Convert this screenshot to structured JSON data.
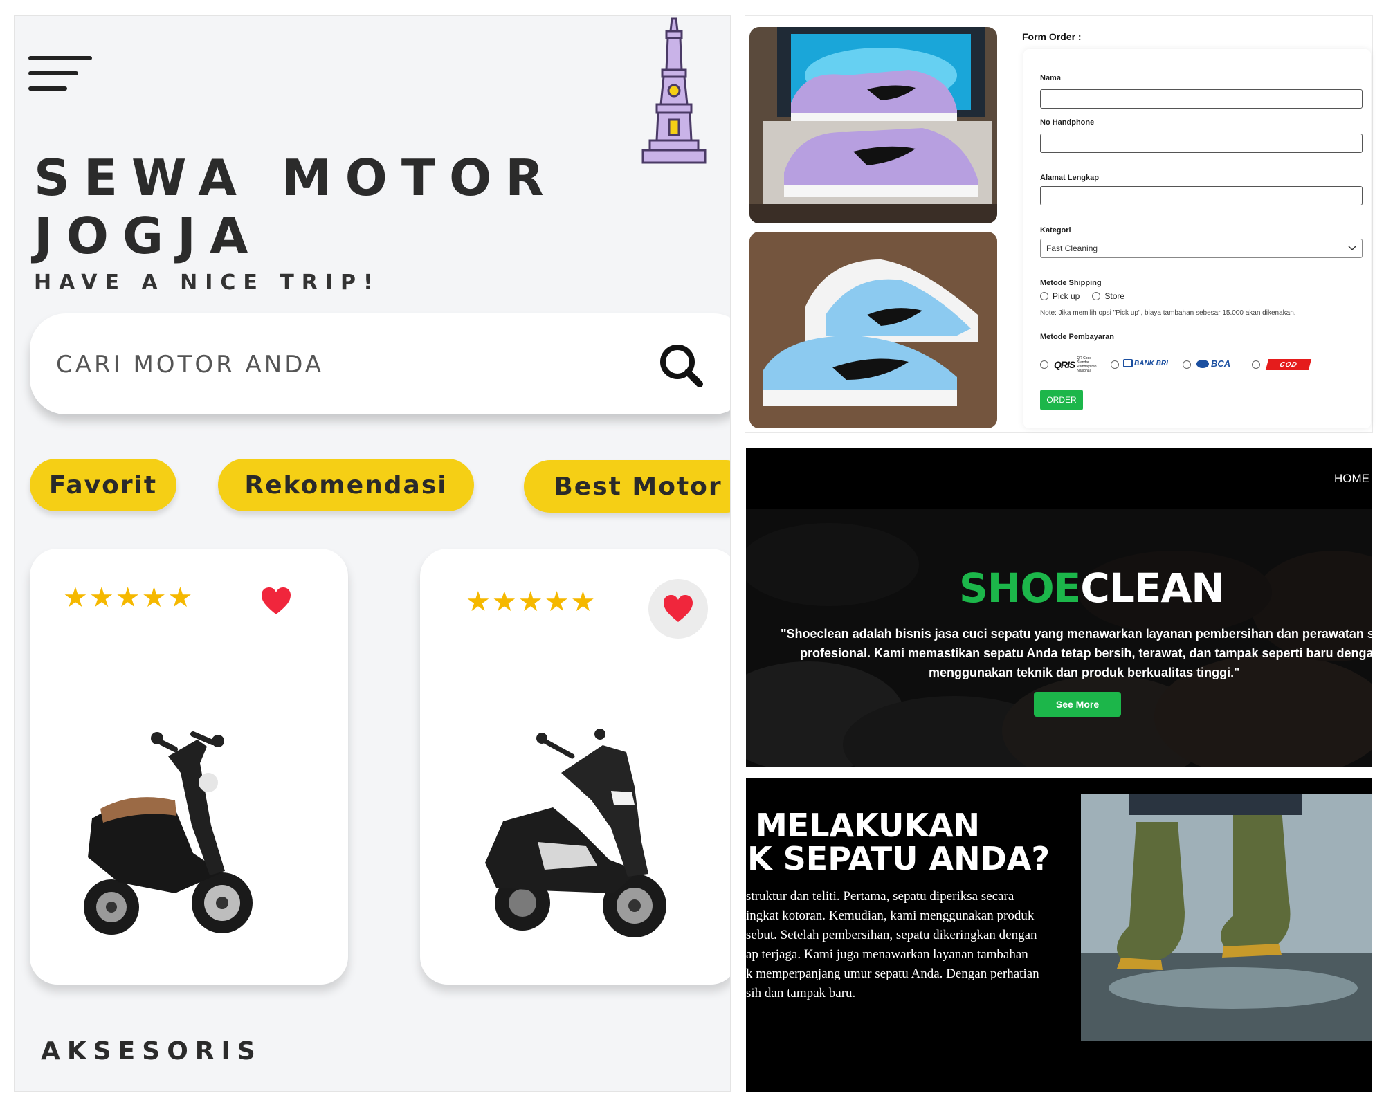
{
  "motor_app": {
    "title_line1": "SEWA MOTOR",
    "title_line2": "JOGJA",
    "subtitle": "HAVE A NICE TRIP!",
    "search": {
      "placeholder": "CARI MOTOR ANDA"
    },
    "chips": [
      {
        "label": "Favorit"
      },
      {
        "label": "Rekomendasi"
      },
      {
        "label": "Best Motor"
      }
    ],
    "cards": [
      {
        "rating": 5,
        "stars": "★★★★★",
        "favorite": true
      },
      {
        "rating": 5,
        "stars": "★★★★★",
        "favorite": true
      }
    ],
    "section_title": "AKSESORIS",
    "colors": {
      "accent": "#f5cf15",
      "heart": "#f0263c",
      "star": "#f5b800",
      "background": "#f4f5f7"
    },
    "icons": [
      "hamburger-menu-icon",
      "tugu-monument-icon",
      "search-icon",
      "heart-icon",
      "star-icon"
    ]
  },
  "order_form": {
    "title": "Form Order :",
    "fields": {
      "nama": {
        "label": "Nama",
        "value": ""
      },
      "hp": {
        "label": "No Handphone",
        "value": ""
      },
      "alamat": {
        "label": "Alamat Lengkap",
        "value": ""
      }
    },
    "kategori": {
      "label": "Kategori",
      "selected": "Fast Cleaning"
    },
    "shipping": {
      "label": "Metode Shipping",
      "options": [
        "Pick up",
        "Store"
      ],
      "note": "Note: Jika memilih opsi \"Pick up\", biaya tambahan sebesar 15.000 akan dikenakan."
    },
    "payment": {
      "label": "Metode Pembayaran",
      "options": [
        "QRIS",
        "BANK BRI",
        "BCA",
        "COD"
      ],
      "qris_caption": "QR Code Standar Pembayaran Nasional"
    },
    "order_button": "ORDER",
    "colors": {
      "button": "#1cb64a"
    }
  },
  "hero": {
    "nav_home": "HOME",
    "brand_part1": "SHOE",
    "brand_part2": "CLEAN",
    "desc_line1": "\"Shoeclean adalah bisnis jasa cuci sepatu yang menawarkan layanan pembersihan dan perawatan sepat",
    "desc_line2": "profesional. Kami memastikan sepatu Anda tetap bersih, terawat, dan tampak seperti baru dengan",
    "desc_line3": "menggunakan teknik dan produk berkualitas tinggi.\"",
    "cta": "See More",
    "colors": {
      "brand_green": "#1cb64a",
      "background": "#000000"
    }
  },
  "process": {
    "heading_line1": "MELAKUKAN",
    "heading_line2": "K SEPATU ANDA?",
    "paragraph": [
      "struktur  dan  teliti.  Pertama,  sepatu  diperiksa  secara",
      "ingkat  kotoran.  Kemudian,  kami  menggunakan  produk",
      "sebut.  Setelah  pembersihan,  sepatu  dikeringkan  dengan",
      "ap  terjaga.  Kami  juga  menawarkan  layanan  tambahan",
      "k memperpanjang umur sepatu Anda. Dengan perhatian",
      "sih dan tampak baru."
    ]
  }
}
